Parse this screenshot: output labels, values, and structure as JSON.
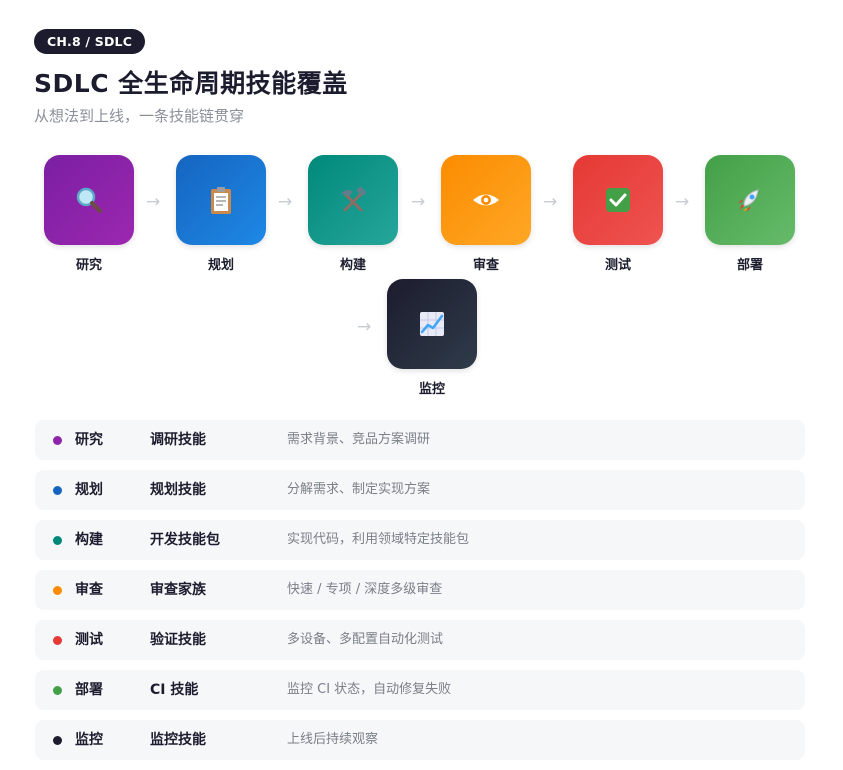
{
  "header": {
    "badge": "CH.8 / SDLC",
    "title": "SDLC 全生命周期技能覆盖",
    "subtitle": "从想法到上线，一条技能链贯穿"
  },
  "flow": {
    "arrow": "→",
    "stages": [
      {
        "label": "研究",
        "icon": "magnifier-icon",
        "color": "#8e24aa"
      },
      {
        "label": "规划",
        "icon": "clipboard-icon",
        "color": "#1e6fd0"
      },
      {
        "label": "构建",
        "icon": "hammer-pick-icon",
        "color": "#12918a"
      },
      {
        "label": "审查",
        "icon": "eye-icon",
        "color": "#ff9a0c"
      },
      {
        "label": "测试",
        "icon": "check-box-icon",
        "color": "#e74747"
      },
      {
        "label": "部署",
        "icon": "rocket-icon",
        "color": "#4caf50"
      },
      {
        "label": "监控",
        "icon": "chart-icon",
        "color": "#232a38"
      }
    ]
  },
  "skills": [
    {
      "stage": "研究",
      "skill": "调研技能",
      "desc": "需求背景、竞品方案调研",
      "color": "#8e24aa"
    },
    {
      "stage": "规划",
      "skill": "规划技能",
      "desc": "分解需求、制定实现方案",
      "color": "#1565c0"
    },
    {
      "stage": "构建",
      "skill": "开发技能包",
      "desc": "实现代码，利用领域特定技能包",
      "color": "#00897b"
    },
    {
      "stage": "审查",
      "skill": "审查家族",
      "desc": "快速 / 专项 / 深度多级审查",
      "color": "#fb8c00"
    },
    {
      "stage": "测试",
      "skill": "验证技能",
      "desc": "多设备、多配置自动化测试",
      "color": "#e53935"
    },
    {
      "stage": "部署",
      "skill": "CI 技能",
      "desc": "监控 CI 状态，自动修复失败",
      "color": "#43a047"
    },
    {
      "stage": "监控",
      "skill": "监控技能",
      "desc": "上线后持续观察",
      "color": "#1c1c2e"
    }
  ]
}
